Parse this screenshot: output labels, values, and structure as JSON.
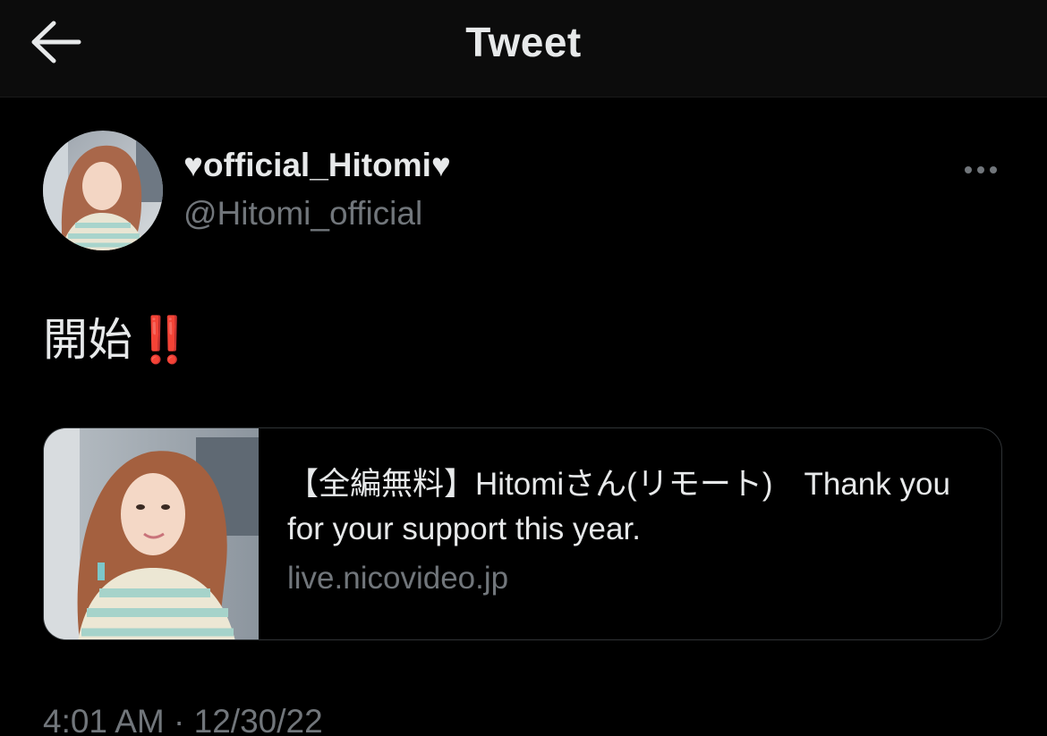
{
  "header": {
    "back_icon": "arrow-left-icon",
    "title": "Tweet"
  },
  "author": {
    "display_name": "♥official_Hitomi♥",
    "handle": "@Hitomi_official",
    "more_icon": "more-dots-icon"
  },
  "tweet": {
    "text": "開始",
    "emoji": "‼️"
  },
  "link_card": {
    "title": "【全編無料】Hitomiさん(リモート)　Thank you for your support this year.",
    "domain": "live.nicovideo.jp"
  },
  "meta": {
    "timestamp": "4:01 AM · 12/30/22"
  },
  "colors": {
    "background": "#000000",
    "header_bg": "#0c0c0c",
    "primary_text": "#e7e9ea",
    "secondary_text": "#71767b",
    "card_border": "#2f3336",
    "emoji_red": "#e0322f"
  }
}
